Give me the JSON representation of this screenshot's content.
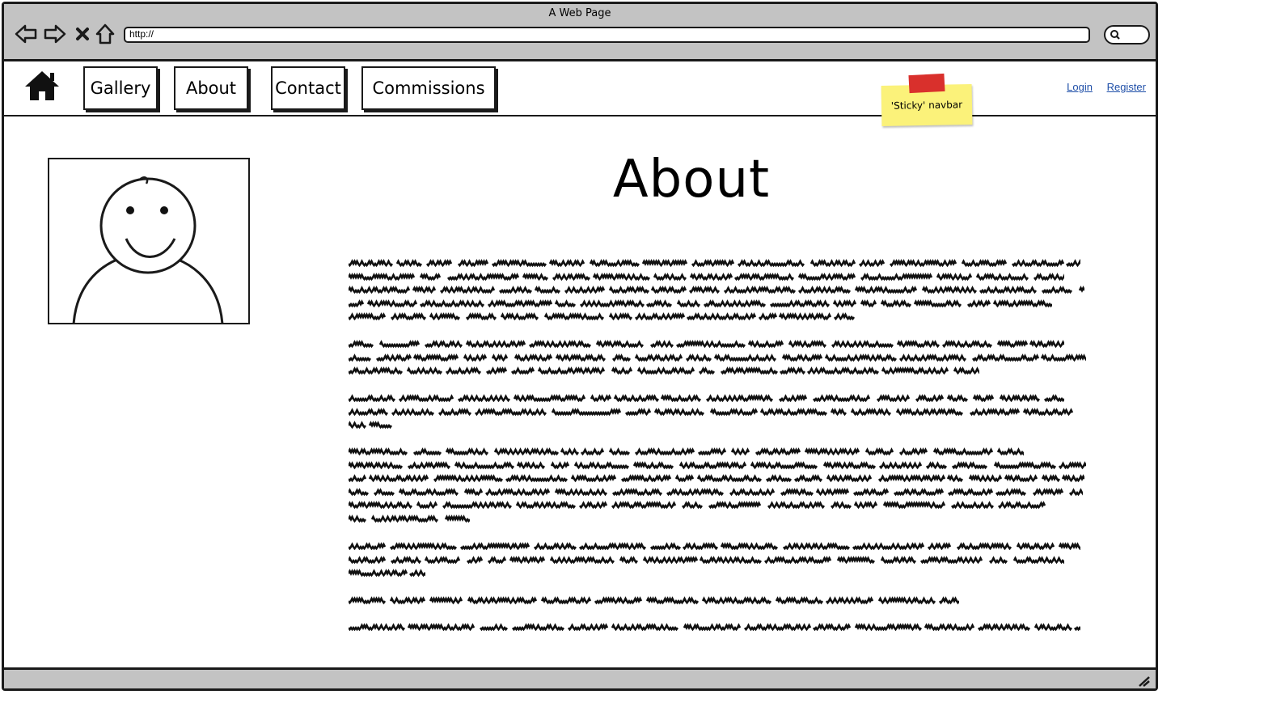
{
  "window": {
    "title": "A Web Page",
    "url": "http://"
  },
  "toolbar": {
    "icons": [
      "back-arrow-icon",
      "forward-arrow-icon",
      "close-x-icon",
      "home-outline-icon",
      "search-icon"
    ]
  },
  "navbar": {
    "home_icon": "home-icon",
    "items": [
      {
        "label": "Gallery"
      },
      {
        "label": "About"
      },
      {
        "label": "Contact"
      },
      {
        "label": "Commissions"
      }
    ],
    "login_label": "Login",
    "register_label": "Register"
  },
  "annotation": {
    "sticky_note": "'Sticky' navbar",
    "note_color": "#fbf27a",
    "tape_color": "#d9302c"
  },
  "main": {
    "heading": "About",
    "profile_image": "avatar-placeholder",
    "paragraphs_lines": [
      5,
      3,
      3,
      6,
      3,
      1,
      1
    ],
    "link_color": "#1f4fa8",
    "chrome_color": "#c3c3c3"
  }
}
